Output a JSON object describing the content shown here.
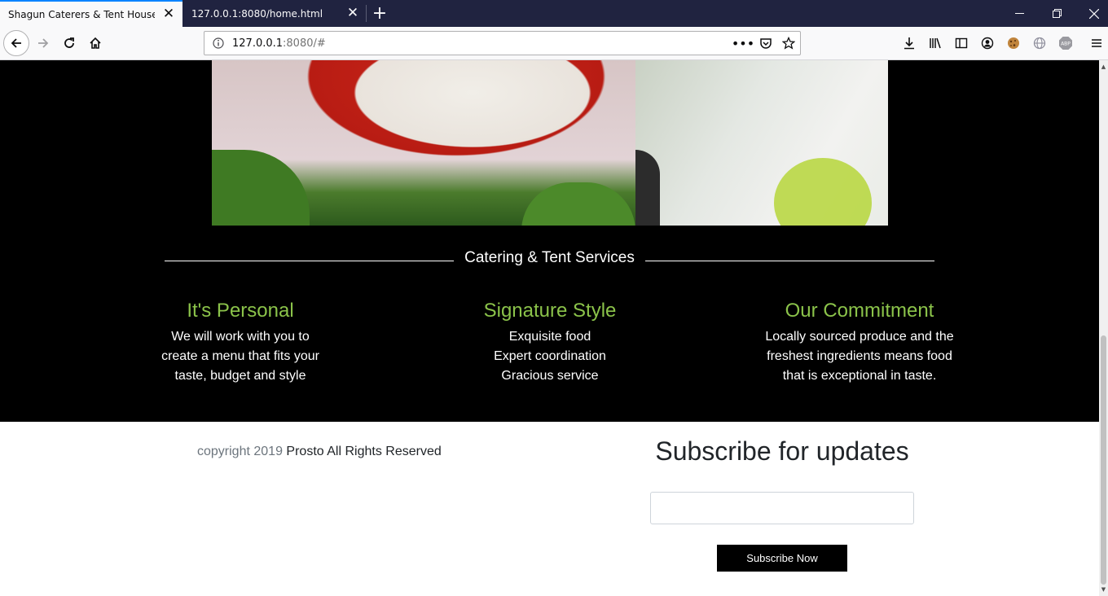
{
  "browser": {
    "tabs": [
      {
        "title": "Shagun Caterers & Tent House",
        "active": true
      },
      {
        "title": "127.0.0.1:8080/home.html",
        "active": false
      }
    ],
    "new_tab_label": "+",
    "url_host": "127.0.0.1",
    "url_rest": ":8080/#",
    "page_actions_label": "•••",
    "accent_color": "#0a84ff"
  },
  "page": {
    "section_title": "Catering & Tent Services",
    "accent_color": "#8bc34a",
    "features": [
      {
        "title": "It's Personal",
        "lines": [
          "We will work with you to",
          "create a menu that fits your",
          "taste, budget and style"
        ]
      },
      {
        "title": "Signature Style",
        "lines": [
          "Exquisite food",
          "Expert coordination",
          "Gracious service"
        ]
      },
      {
        "title": "Our Commitment",
        "lines": [
          "Locally sourced produce and the",
          "freshest ingredients means food",
          "that is exceptional in taste."
        ]
      }
    ],
    "footer": {
      "copyright_prefix": "copyright 2019",
      "brand": "Prosto",
      "rights": "All Rights Reserved"
    },
    "subscribe": {
      "title": "Subscribe for updates",
      "input_value": "",
      "button_label": "Subscribe Now"
    }
  }
}
